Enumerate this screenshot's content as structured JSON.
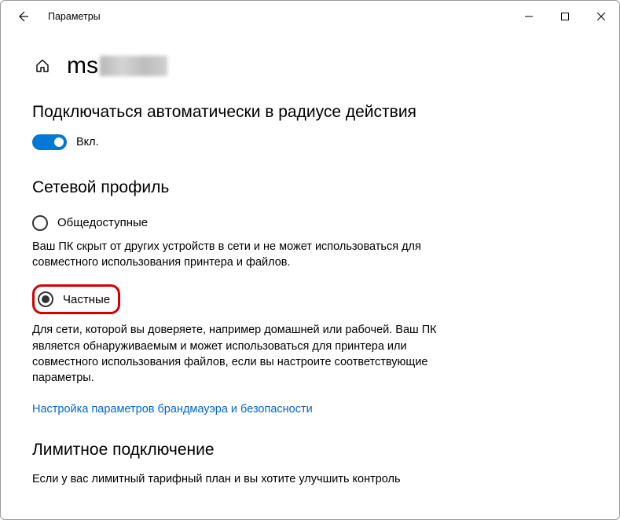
{
  "window": {
    "title": "Параметры"
  },
  "page": {
    "title_prefix": "ms"
  },
  "autoconnect": {
    "heading": "Подключаться автоматически в радиусе действия",
    "toggle_label": "Вкл.",
    "toggle_on": true
  },
  "network_profile": {
    "heading": "Сетевой профиль",
    "public": {
      "label": "Общедоступные",
      "desc": "Ваш ПК скрыт от других устройств в сети и не может использоваться для совместного использования принтера и файлов."
    },
    "private": {
      "label": "Частные",
      "desc": "Для сети, которой вы доверяете, например домашней или рабочей. Ваш ПК является обнаруживаемым и может использоваться для принтера или совместного использования файлов, если вы настроите соответствующие параметры."
    },
    "firewall_link": "Настройка параметров брандмауэра и безопасности"
  },
  "metered": {
    "heading": "Лимитное подключение",
    "desc": "Если у вас лимитный тарифный план и вы хотите улучшить контроль"
  },
  "colors": {
    "accent": "#0078d4",
    "link": "#0066cc",
    "highlight_border": "#d40000"
  }
}
